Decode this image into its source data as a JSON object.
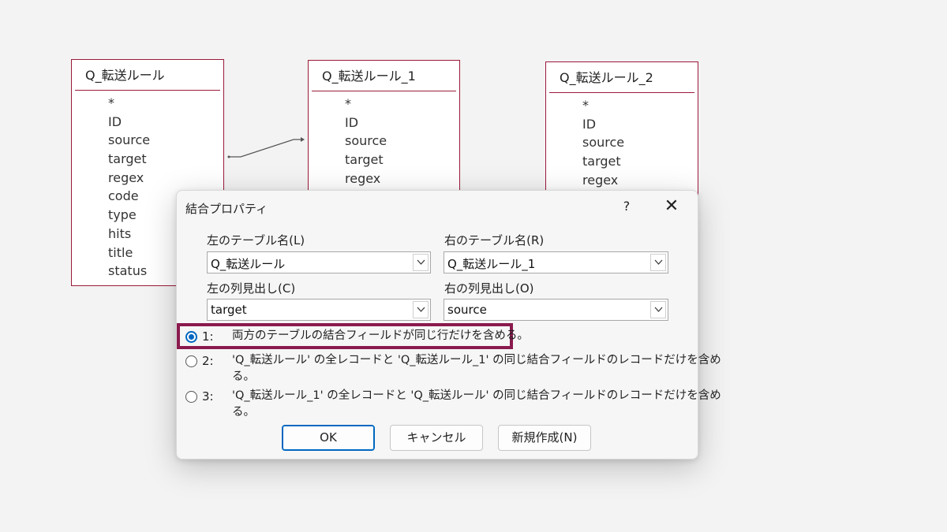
{
  "tables": [
    {
      "title": "Q_転送ルール",
      "fields": [
        "*",
        "ID",
        "source",
        "target",
        "regex",
        "code",
        "type",
        "hits",
        "title",
        "status"
      ]
    },
    {
      "title": "Q_転送ルール_1",
      "fields": [
        "*",
        "ID",
        "source",
        "target",
        "regex"
      ]
    },
    {
      "title": "Q_転送ルール_2",
      "fields": [
        "*",
        "ID",
        "source",
        "target",
        "regex"
      ]
    }
  ],
  "dialog": {
    "title": "結合プロパティ",
    "help": "?",
    "close": "✕",
    "left_table_label": "左のテーブル名(L)",
    "left_table_value": "Q_転送ルール",
    "right_table_label": "右のテーブル名(R)",
    "right_table_value": "Q_転送ルール_1",
    "left_column_label": "左の列見出し(C)",
    "left_column_value": "target",
    "right_column_label": "右の列見出し(O)",
    "right_column_value": "source",
    "options": [
      {
        "num": "1:",
        "text": "両方のテーブルの結合フィールドが同じ行だけを含める。",
        "selected": true
      },
      {
        "num": "2:",
        "text": "'Q_転送ルール' の全レコードと 'Q_転送ルール_1' の同じ結合フィールドのレコードだけを含め",
        "text2": "る。",
        "selected": false
      },
      {
        "num": "3:",
        "text": "'Q_転送ルール_1' の全レコードと 'Q_転送ルール' の同じ結合フィールドのレコードだけを含め",
        "text2": "る。",
        "selected": false
      }
    ],
    "buttons": {
      "ok": "OK",
      "cancel": "キャンセル",
      "new": "新規作成(N)"
    }
  },
  "colors": {
    "table_border": "#9b1a3a",
    "highlight": "#8b1a4e",
    "accent": "#0067c0"
  }
}
